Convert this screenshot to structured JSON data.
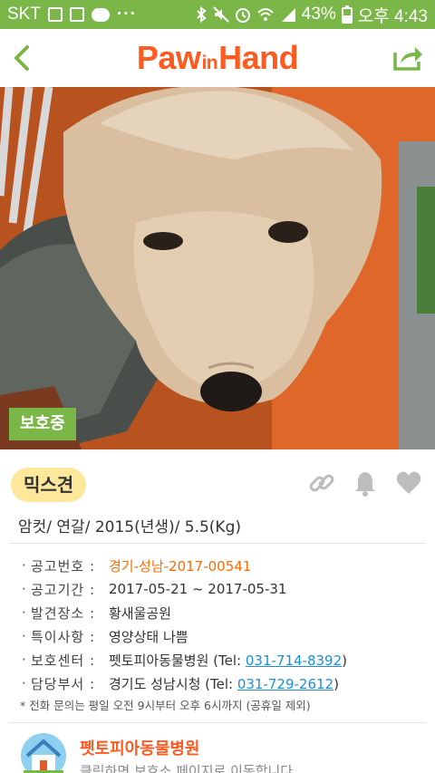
{
  "status_bar": {
    "carrier": "SKT",
    "battery": "43%",
    "time": "오후 4:43"
  },
  "header": {
    "logo_left": "Paw",
    "logo_mid": "in",
    "logo_right": "Hand",
    "brand_color": "#ff5a1f"
  },
  "photo": {
    "status_tag": "보호중"
  },
  "animal": {
    "breed": "믹스견",
    "summary": "암컷/ 연갈/ 2015(년생)/ 5.5(Kg)"
  },
  "details": {
    "notice_no_label": "공고번호 :",
    "notice_no": "경기-성남-2017-00541",
    "period_label": "공고기간 :",
    "period": "2017-05-21 ~ 2017-05-31",
    "place_label": "발견장소 :",
    "place": "황새울공원",
    "feature_label": "특이사항 :",
    "feature": "영양상태 나쁨",
    "center_label": "보호센터 :",
    "center_name": "펫토피아동물병원 (Tel: ",
    "center_phone": "031-714-8392",
    "center_close": ")",
    "dept_label": "담당부서 :",
    "dept_name": "경기도 성남시청 (Tel: ",
    "dept_phone": "031-729-2612",
    "dept_close": ")",
    "bullet": "·"
  },
  "notice": "* 전화 문의는 평일 오전 9시부터 오후 6시까지 (공휴일 제외)",
  "shelter": {
    "name": "펫토피아동물병원",
    "subtitle": "클릭하면 보호소 페이지로 이동합니다"
  },
  "colors": {
    "green": "#7ab648",
    "orange": "#ff6a00",
    "link": "#1a8fd6",
    "pill": "#fde79a"
  }
}
